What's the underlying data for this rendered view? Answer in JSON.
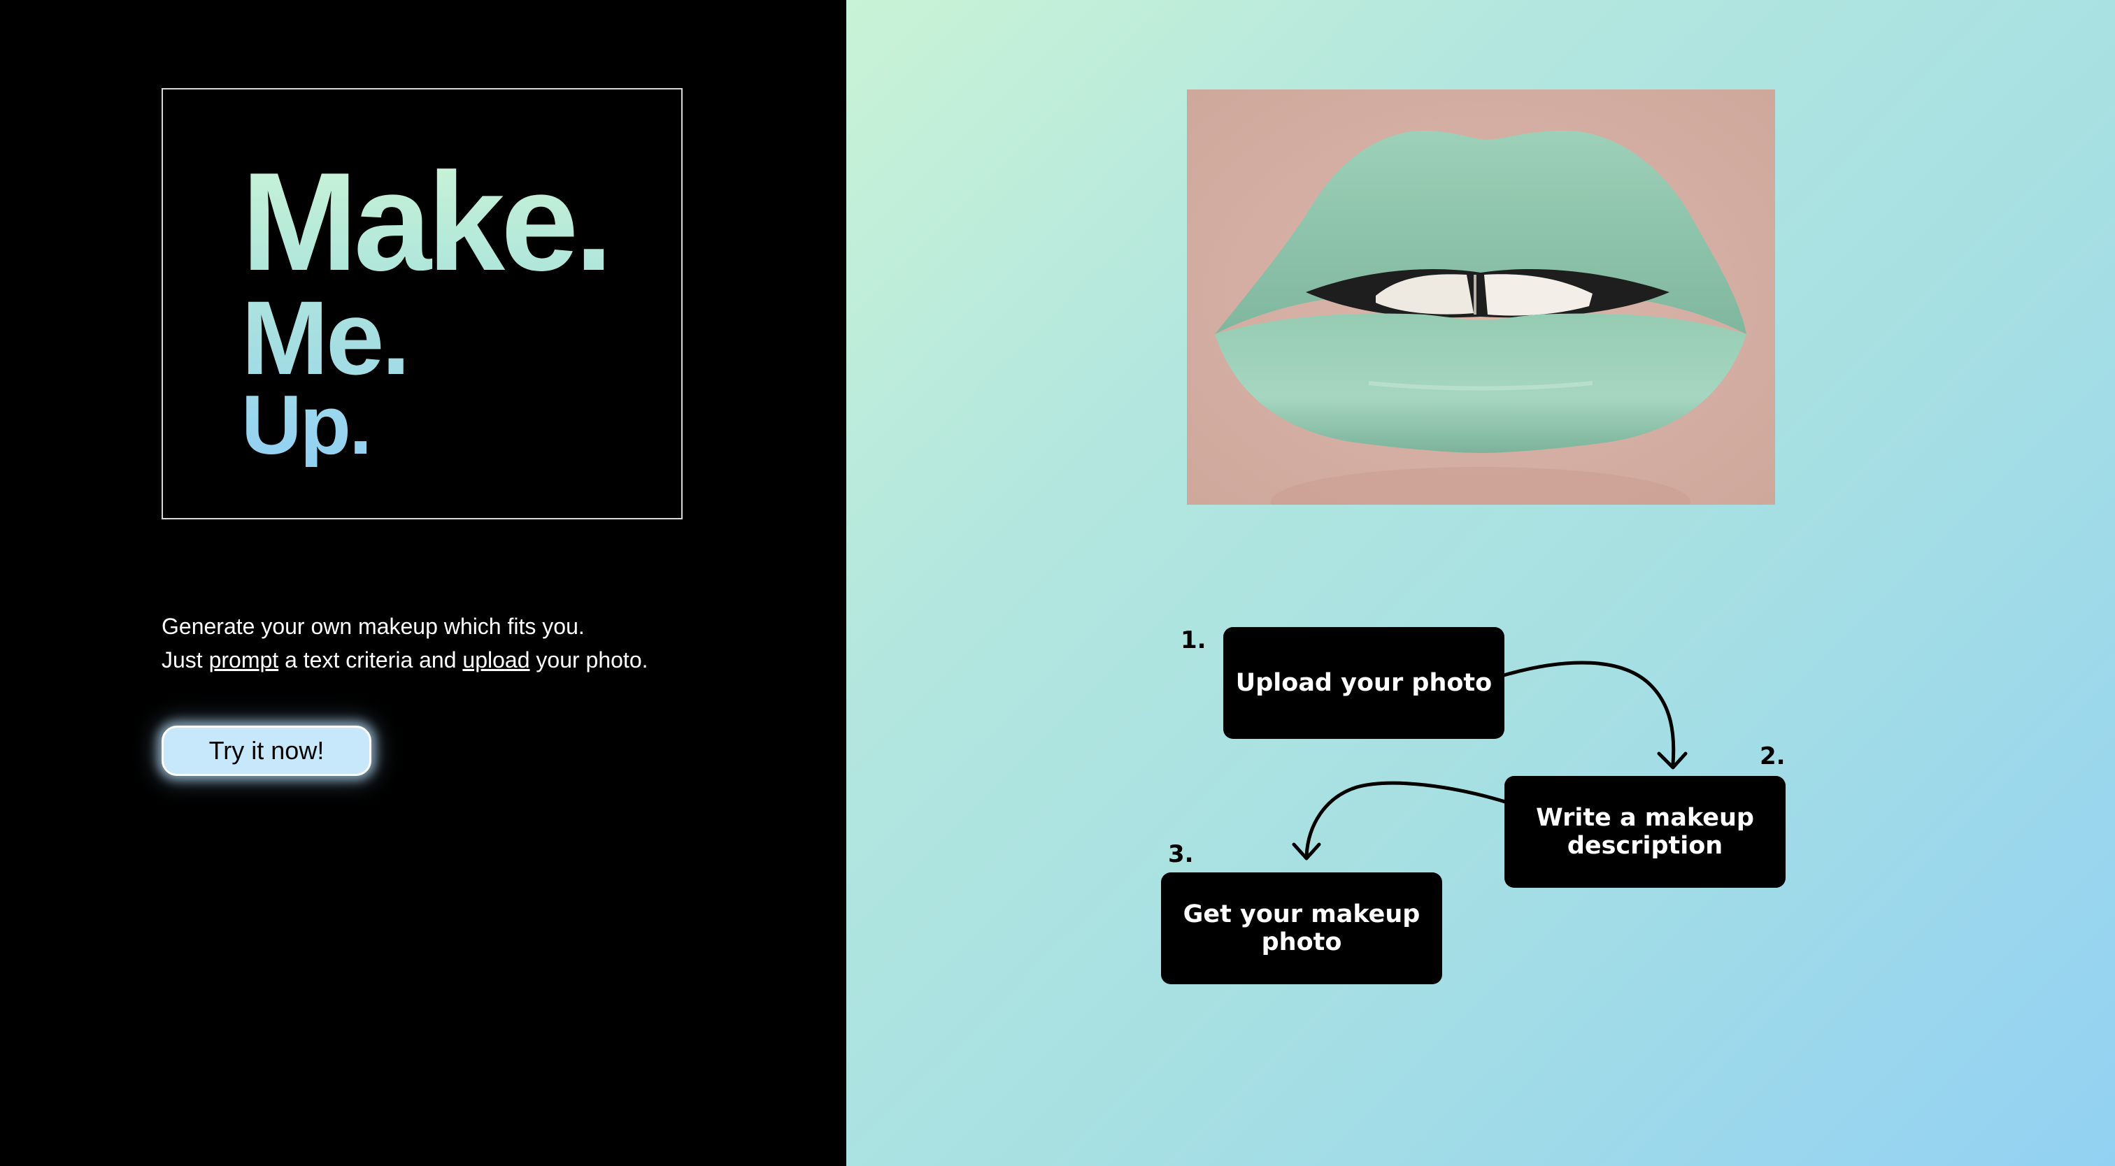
{
  "hero": {
    "title_line1": "Make.",
    "title_line2": "Me.",
    "title_line3": "Up."
  },
  "tagline": {
    "line1": "Generate your own makeup which fits you.",
    "line2_prefix": "Just ",
    "prompt_link": "prompt",
    "line2_middle": " a text criteria and ",
    "upload_link": "upload",
    "line2_suffix": " your photo."
  },
  "cta": {
    "label": "Try it now!"
  },
  "colors": {
    "left_background": "#000000",
    "gradient_start": "#c9f3d6",
    "gradient_end": "#93d1f3",
    "button": "#c7e7fb",
    "lipstick": "#8fc7ae"
  },
  "image": {
    "subject": "mint green lips"
  },
  "steps": [
    {
      "number": "1.",
      "label": "Upload your photo"
    },
    {
      "number": "2.",
      "label": "Write a makeup description"
    },
    {
      "number": "3.",
      "label": "Get your makeup photo"
    }
  ]
}
